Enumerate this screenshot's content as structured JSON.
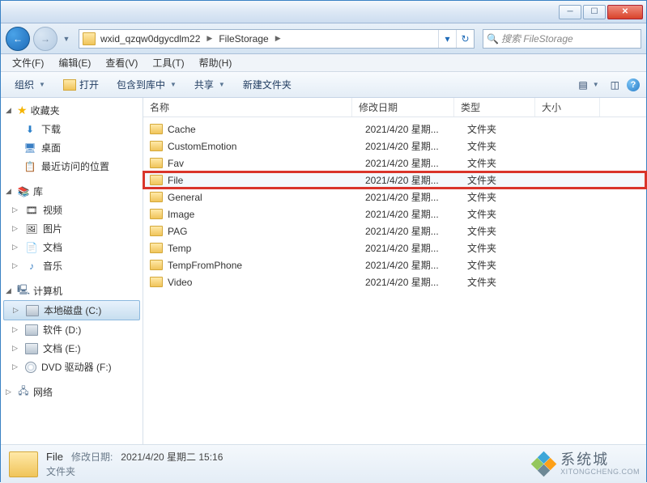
{
  "breadcrumb": {
    "seg1": "wxid_qzqw0dgycdlm22",
    "seg2": "FileStorage"
  },
  "search": {
    "placeholder": "搜索 FileStorage"
  },
  "menus": {
    "file": "文件(F)",
    "edit": "编辑(E)",
    "view": "查看(V)",
    "tools": "工具(T)",
    "help": "帮助(H)"
  },
  "toolbar": {
    "organize": "组织",
    "open": "打开",
    "include": "包含到库中",
    "share": "共享",
    "newfolder": "新建文件夹"
  },
  "sidebar": {
    "favorites": "收藏夹",
    "downloads": "下载",
    "desktop": "桌面",
    "recent": "最近访问的位置",
    "libraries": "库",
    "videos": "视频",
    "pictures": "图片",
    "documents": "文档",
    "music": "音乐",
    "computer": "计算机",
    "localc": "本地磁盘 (C:)",
    "softd": "软件 (D:)",
    "doce": "文档 (E:)",
    "dvdf": "DVD 驱动器 (F:)",
    "network": "网络"
  },
  "columns": {
    "name": "名称",
    "date": "修改日期",
    "type": "类型",
    "size": "大小"
  },
  "files": [
    {
      "name": "Cache",
      "date": "2021/4/20 星期...",
      "type": "文件夹"
    },
    {
      "name": "CustomEmotion",
      "date": "2021/4/20 星期...",
      "type": "文件夹"
    },
    {
      "name": "Fav",
      "date": "2021/4/20 星期...",
      "type": "文件夹"
    },
    {
      "name": "File",
      "date": "2021/4/20 星期...",
      "type": "文件夹",
      "highlighted": true
    },
    {
      "name": "General",
      "date": "2021/4/20 星期...",
      "type": "文件夹"
    },
    {
      "name": "Image",
      "date": "2021/4/20 星期...",
      "type": "文件夹"
    },
    {
      "name": "PAG",
      "date": "2021/4/20 星期...",
      "type": "文件夹"
    },
    {
      "name": "Temp",
      "date": "2021/4/20 星期...",
      "type": "文件夹"
    },
    {
      "name": "TempFromPhone",
      "date": "2021/4/20 星期...",
      "type": "文件夹"
    },
    {
      "name": "Video",
      "date": "2021/4/20 星期...",
      "type": "文件夹"
    }
  ],
  "details": {
    "name": "File",
    "date_label": "修改日期:",
    "date_value": "2021/4/20 星期二 15:16",
    "type": "文件夹"
  },
  "watermark": {
    "cn": "系统城",
    "en": "XITONGCHENG.COM"
  }
}
